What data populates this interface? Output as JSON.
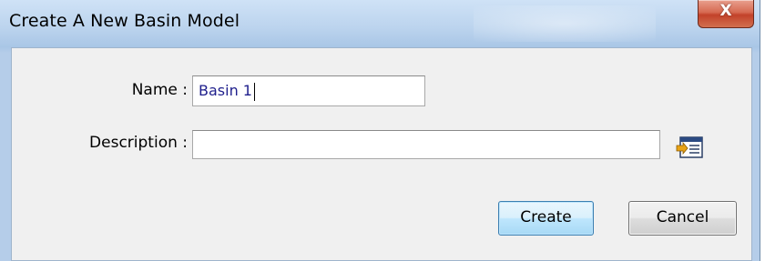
{
  "window": {
    "title": "Create A New Basin Model",
    "close_glyph": "X"
  },
  "form": {
    "name_label": "Name :",
    "name_value": "Basin 1",
    "description_label": "Description :",
    "description_value": "",
    "browse_icon": "text-import-icon"
  },
  "buttons": {
    "create_label": "Create",
    "cancel_label": "Cancel"
  },
  "colors": {
    "titlebar": "#bcd4ee",
    "client_background": "#f0f0f0",
    "input_text": "#1f1f8c",
    "close_button": "#c2422a",
    "default_button_border": "#3c7fb1"
  }
}
